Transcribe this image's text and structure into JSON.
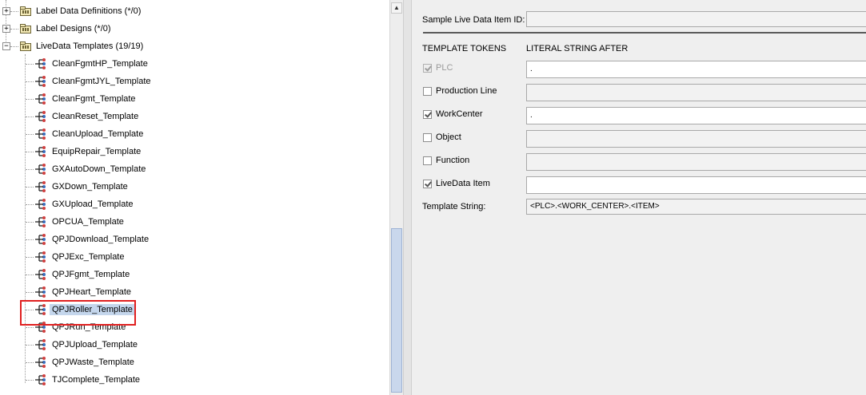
{
  "tree": {
    "folders": [
      {
        "label": "Label Data Definitions (*/0)",
        "expander": "+"
      },
      {
        "label": "Label Designs (*/0)",
        "expander": "+"
      },
      {
        "label": "LiveData Templates (19/19)",
        "expander": "−"
      }
    ],
    "templates": [
      {
        "label": "CleanFgmtHP_Template"
      },
      {
        "label": "CleanFgmtJYL_Template"
      },
      {
        "label": "CleanFgmt_Template"
      },
      {
        "label": "CleanReset_Template"
      },
      {
        "label": "CleanUpload_Template"
      },
      {
        "label": "EquipRepair_Template"
      },
      {
        "label": "GXAutoDown_Template"
      },
      {
        "label": "GXDown_Template"
      },
      {
        "label": "GXUpload_Template"
      },
      {
        "label": "OPCUA_Template"
      },
      {
        "label": "QPJDownload_Template"
      },
      {
        "label": "QPJExc_Template"
      },
      {
        "label": "QPJFgmt_Template"
      },
      {
        "label": "QPJHeart_Template"
      },
      {
        "label": "QPJRoller_Template",
        "selected": true
      },
      {
        "label": "QPJRun_Template"
      },
      {
        "label": "QPJUpload_Template"
      },
      {
        "label": "QPJWaste_Template"
      },
      {
        "label": "TJComplete_Template"
      }
    ],
    "scroll_up_glyph": "▲"
  },
  "detail": {
    "sample_label": "Sample Live Data Item ID:",
    "sample_value": "",
    "tokens_header": "TEMPLATE TOKENS",
    "literal_header": "LITERAL STRING AFTER",
    "tokens": [
      {
        "label": "PLC",
        "checked": true,
        "disabled": true,
        "literal": ".",
        "active": true
      },
      {
        "label": "Production Line",
        "checked": false,
        "disabled": false,
        "literal": "",
        "active": false
      },
      {
        "label": "WorkCenter",
        "checked": true,
        "disabled": false,
        "literal": ".",
        "active": true
      },
      {
        "label": "Object",
        "checked": false,
        "disabled": false,
        "literal": "",
        "active": false
      },
      {
        "label": "Function",
        "checked": false,
        "disabled": false,
        "literal": "",
        "active": false
      },
      {
        "label": "LiveData Item",
        "checked": true,
        "disabled": false,
        "literal": "",
        "active": true
      }
    ],
    "template_string_label": "Template String:",
    "template_string_value": "<PLC>.<WORK_CENTER>.<ITEM>"
  },
  "colors": {
    "selection": "#c4d6ec",
    "highlight_box": "#e02020",
    "panel_bg": "#efefef"
  },
  "icons": {
    "folder": "folder-icon",
    "template": "template-tree-icon",
    "expand": "plus-expander-icon",
    "collapse": "minus-expander-icon"
  }
}
